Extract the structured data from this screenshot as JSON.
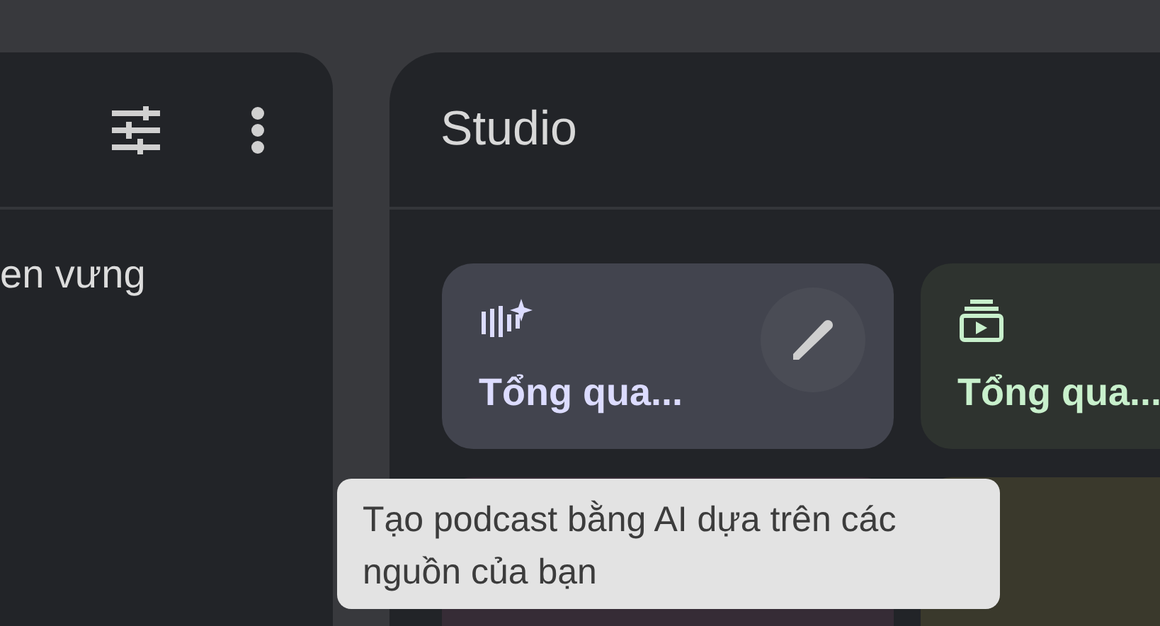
{
  "sources_panel": {
    "visible_text": "en vưng"
  },
  "studio": {
    "title": "Studio",
    "cards": [
      {
        "kind": "audio",
        "title": "Tổng qua...",
        "color": "#dcdcff",
        "hovered": true
      },
      {
        "kind": "video",
        "title": "Tổng qua...",
        "color": "#c8f0cc",
        "hovered": false
      },
      {
        "kind": "mindmap",
        "hovered": false
      },
      {
        "kind": "report",
        "hovered": false
      }
    ]
  },
  "tooltip": {
    "text": "Tạo podcast bằng AI dựa trên các nguồn của bạn"
  }
}
